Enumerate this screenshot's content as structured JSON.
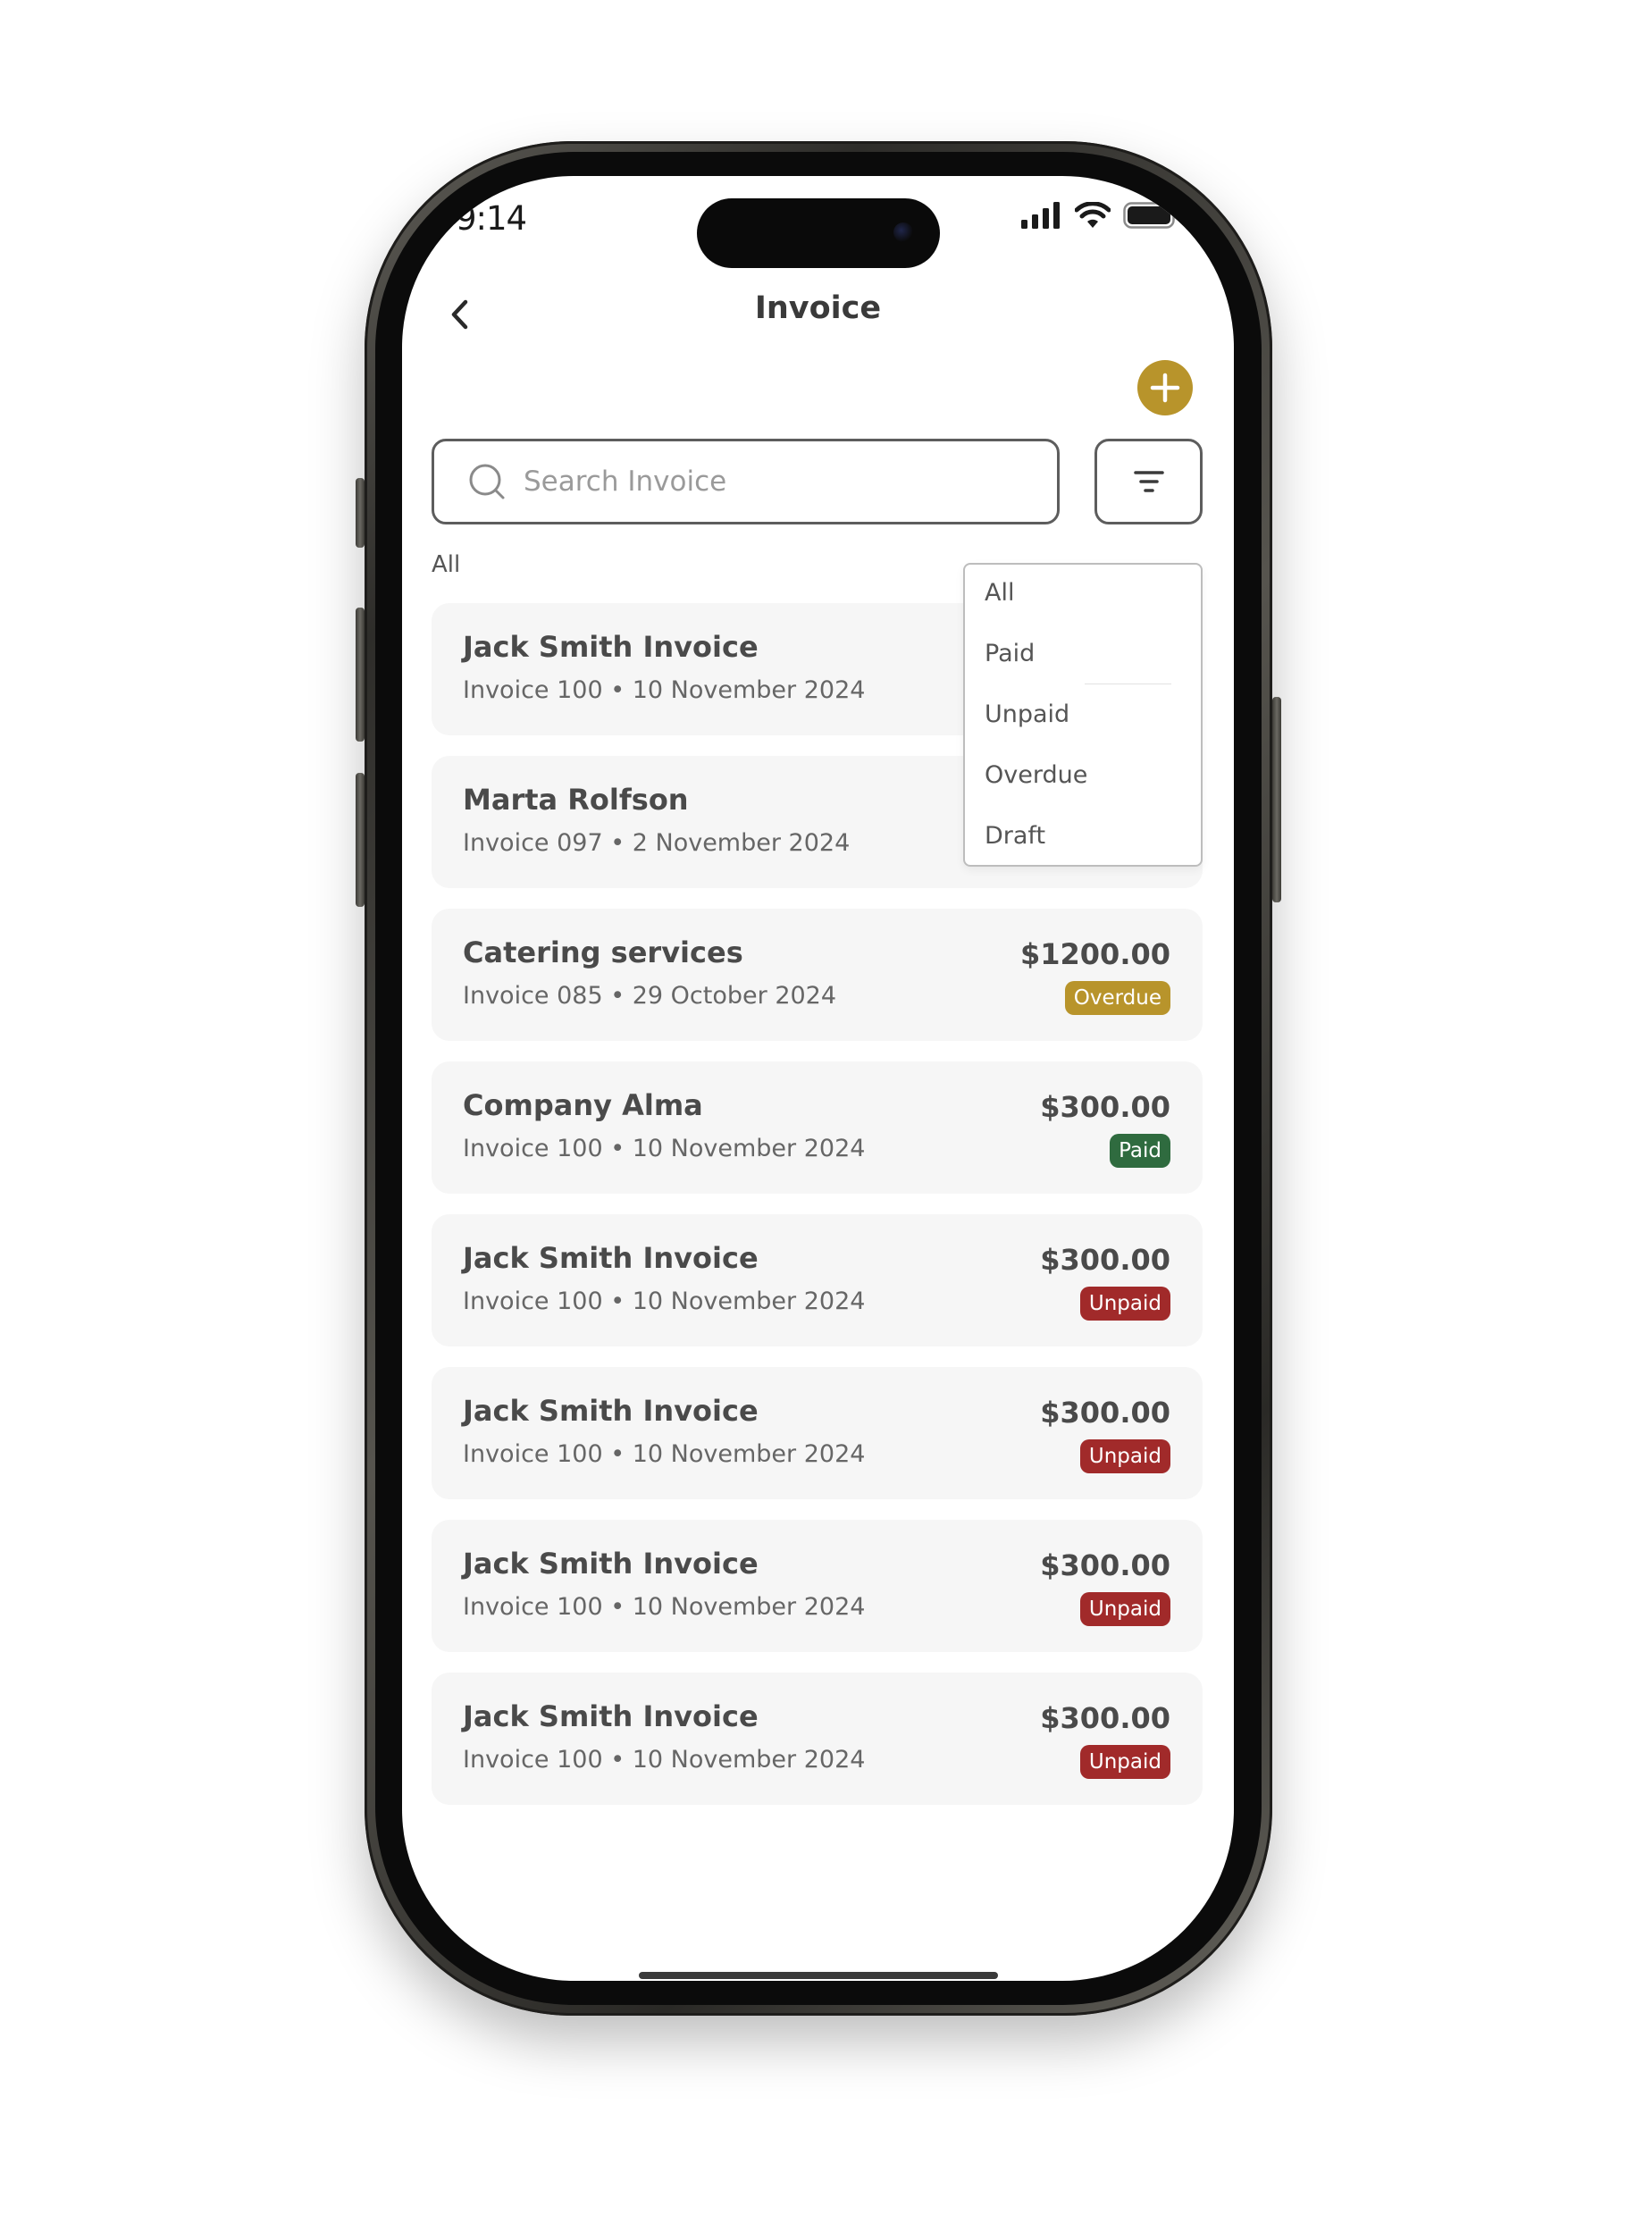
{
  "status_bar": {
    "time": "9:14"
  },
  "header": {
    "title": "Invoice"
  },
  "search": {
    "placeholder": "Search Invoice"
  },
  "filter": {
    "current": "All",
    "options": [
      "All",
      "Paid",
      "Unpaid",
      "Overdue",
      "Draft"
    ]
  },
  "colors": {
    "accent": "#b8942b",
    "overdue": "#b8942b",
    "paid": "#2f6b3f",
    "unpaid": "#a12a2a"
  },
  "invoices": [
    {
      "name": "Jack Smith Invoice",
      "meta": "Invoice 100 • 10 November 2024",
      "amount": "",
      "status": ""
    },
    {
      "name": "Marta Rolfson",
      "meta": "Invoice 097 • 2 November 2024",
      "amount": "",
      "status": ""
    },
    {
      "name": "Catering services",
      "meta": "Invoice 085 • 29 October 2024",
      "amount": "$1200.00",
      "status": "Overdue"
    },
    {
      "name": "Company Alma",
      "meta": "Invoice 100 • 10 November 2024",
      "amount": "$300.00",
      "status": "Paid"
    },
    {
      "name": "Jack Smith Invoice",
      "meta": "Invoice 100 • 10 November 2024",
      "amount": "$300.00",
      "status": "Unpaid"
    },
    {
      "name": "Jack Smith Invoice",
      "meta": "Invoice 100 • 10 November 2024",
      "amount": "$300.00",
      "status": "Unpaid"
    },
    {
      "name": "Jack Smith Invoice",
      "meta": "Invoice 100 • 10 November 2024",
      "amount": "$300.00",
      "status": "Unpaid"
    },
    {
      "name": "Jack Smith Invoice",
      "meta": "Invoice 100 • 10 November 2024",
      "amount": "$300.00",
      "status": "Unpaid"
    }
  ],
  "icons": {
    "back": "chevron-left-icon",
    "add": "plus-icon",
    "search": "search-icon",
    "filter": "filter-icon",
    "signal": "signal-icon",
    "wifi": "wifi-icon",
    "battery": "battery-icon"
  }
}
